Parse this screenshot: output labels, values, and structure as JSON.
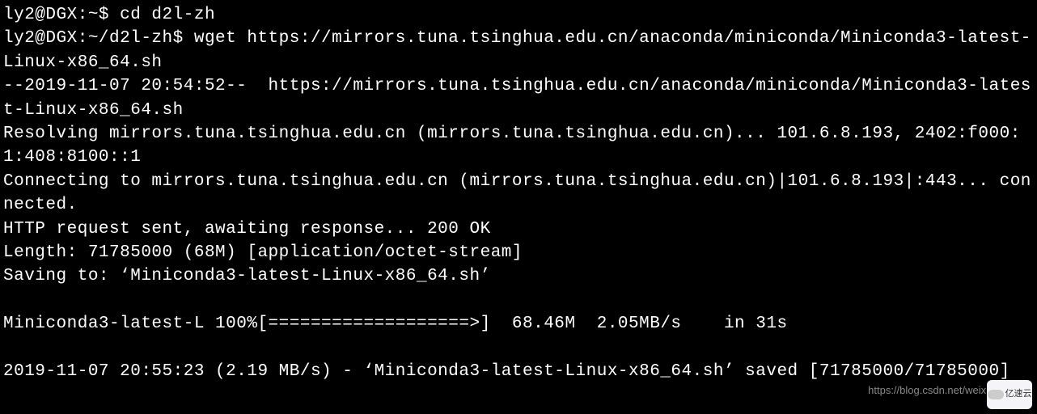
{
  "terminal": {
    "lines": [
      "ly2@DGX:~$ cd d2l-zh",
      "ly2@DGX:~/d2l-zh$ wget https://mirrors.tuna.tsinghua.edu.cn/anaconda/miniconda/Miniconda3-latest-Linux-x86_64.sh",
      "--2019-11-07 20:54:52--  https://mirrors.tuna.tsinghua.edu.cn/anaconda/miniconda/Miniconda3-latest-Linux-x86_64.sh",
      "Resolving mirrors.tuna.tsinghua.edu.cn (mirrors.tuna.tsinghua.edu.cn)... 101.6.8.193, 2402:f000:1:408:8100::1",
      "Connecting to mirrors.tuna.tsinghua.edu.cn (mirrors.tuna.tsinghua.edu.cn)|101.6.8.193|:443... connected.",
      "HTTP request sent, awaiting response... 200 OK",
      "Length: 71785000 (68M) [application/octet-stream]",
      "Saving to: ‘Miniconda3-latest-Linux-x86_64.sh’",
      "",
      "Miniconda3-latest-L 100%[===================>]  68.46M  2.05MB/s    in 31s",
      "",
      "2019-11-07 20:55:23 (2.19 MB/s) - ‘Miniconda3-latest-Linux-x86_64.sh’ saved [71785000/71785000]"
    ],
    "prompt1": "ly2@DGX:~$",
    "command1": "cd d2l-zh",
    "prompt2": "ly2@DGX:~/d2l-zh$",
    "command2": "wget https://mirrors.tuna.tsinghua.edu.cn/anaconda/miniconda/Miniconda3-latest-Linux-x86_64.sh",
    "download": {
      "timestamp_start": "2019-11-07 20:54:52",
      "url": "https://mirrors.tuna.tsinghua.edu.cn/anaconda/miniconda/Miniconda3-latest-Linux-x86_64.sh",
      "host": "mirrors.tuna.tsinghua.edu.cn",
      "ip_v4": "101.6.8.193",
      "ip_v6": "2402:f000:1:408:8100::1",
      "port": "443",
      "http_status": "200 OK",
      "length_bytes": "71785000",
      "length_human": "68M",
      "content_type": "application/octet-stream",
      "filename": "Miniconda3-latest-Linux-x86_64.sh",
      "progress_percent": "100%",
      "progress_bar": "[===================>]",
      "downloaded": "68.46M",
      "speed": "2.05MB/s",
      "elapsed": "31s",
      "timestamp_end": "2019-11-07 20:55:23",
      "avg_speed": "2.19 MB/s",
      "saved_bytes": "71785000/71785000"
    }
  },
  "watermark": {
    "text": "https://blog.csdn.net/weixi",
    "badge": "亿速云"
  }
}
